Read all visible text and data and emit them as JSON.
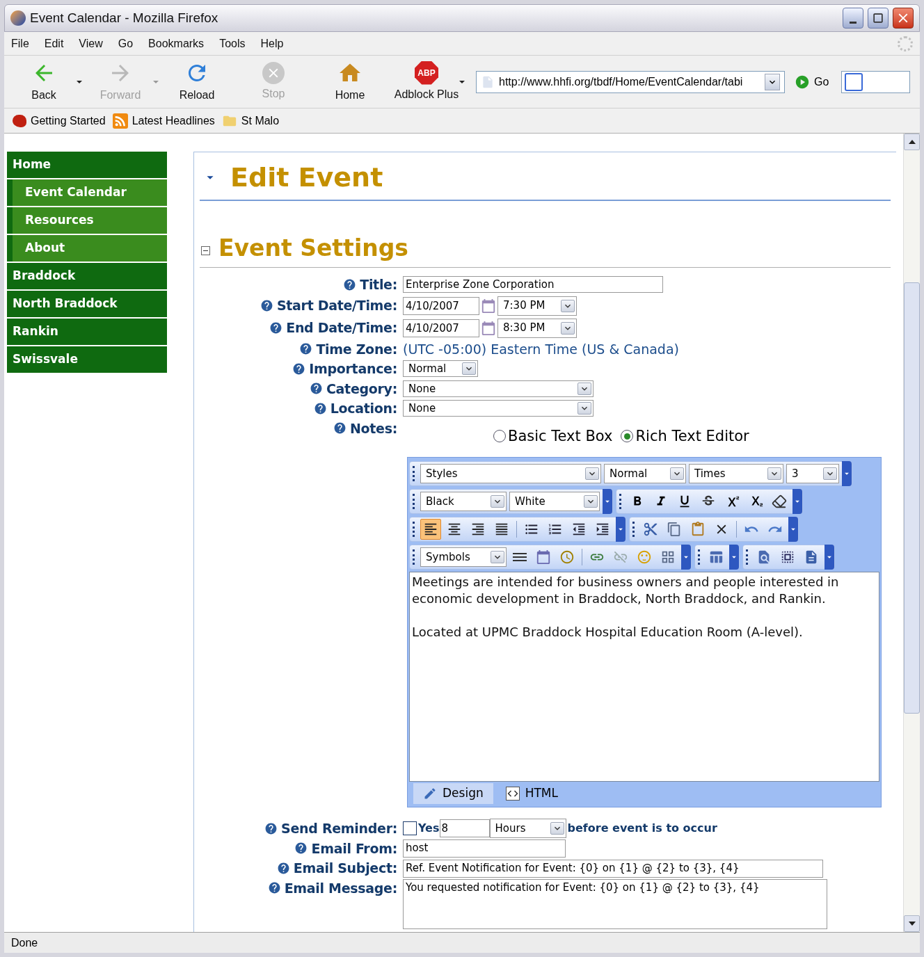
{
  "window": {
    "title": "Event Calendar - Mozilla Firefox"
  },
  "menu": [
    {
      "label": "File"
    },
    {
      "label": "Edit"
    },
    {
      "label": "View"
    },
    {
      "label": "Go"
    },
    {
      "label": "Bookmarks"
    },
    {
      "label": "Tools"
    },
    {
      "label": "Help"
    }
  ],
  "nav_buttons": [
    {
      "kind": "back",
      "label": "Back",
      "disabled": false,
      "dropdown": true
    },
    {
      "kind": "forward",
      "label": "Forward",
      "disabled": true,
      "dropdown": true
    },
    {
      "kind": "reload",
      "label": "Reload",
      "disabled": false,
      "dropdown": false
    },
    {
      "kind": "stop",
      "label": "Stop",
      "disabled": true,
      "dropdown": false
    },
    {
      "kind": "home",
      "label": "Home",
      "disabled": false,
      "dropdown": false
    },
    {
      "kind": "adblock",
      "label": "Adblock Plus",
      "badge": "ABP",
      "disabled": false,
      "dropdown": true
    }
  ],
  "address": {
    "value": "http://www.hhfi.org/tbdf/Home/EventCalendar/tabi"
  },
  "go": {
    "label": "Go"
  },
  "bookmarks": [
    {
      "kind": "starter",
      "label": "Getting Started"
    },
    {
      "kind": "feed",
      "label": "Latest Headlines"
    },
    {
      "kind": "folder",
      "label": "St Malo"
    }
  ],
  "sidebar": {
    "items": [
      {
        "label": "Home",
        "children": [
          {
            "label": "Event Calendar"
          },
          {
            "label": "Resources"
          },
          {
            "label": "About"
          }
        ]
      },
      {
        "label": "Braddock"
      },
      {
        "label": "North Braddock"
      },
      {
        "label": "Rankin"
      },
      {
        "label": "Swissvale"
      }
    ]
  },
  "page": {
    "heading": "Edit Event",
    "heading_expanded": true,
    "section": {
      "title": "Event Settings",
      "expanded": true
    }
  },
  "form": {
    "fields": [
      {
        "kind": "text",
        "label": "Title:",
        "value": "Enterprise Zone Corporation"
      },
      {
        "kind": "datetime",
        "label": "Start Date/Time:",
        "date": "4/10/2007",
        "time": "7:30 PM"
      },
      {
        "kind": "datetime",
        "label": "End Date/Time:",
        "date": "4/10/2007",
        "time": "8:30 PM"
      },
      {
        "kind": "static",
        "label": "Time Zone:",
        "value": "(UTC -05:00) Eastern Time (US & Canada)"
      },
      {
        "kind": "short-select",
        "label": "Importance:",
        "value": "Normal"
      },
      {
        "kind": "select",
        "label": "Category:",
        "value": "None"
      },
      {
        "kind": "select",
        "label": "Location:",
        "value": "None"
      },
      {
        "kind": "notes",
        "label": "Notes:"
      }
    ]
  },
  "editor": {
    "modes": [
      {
        "label": "Basic Text Box",
        "selected": false
      },
      {
        "label": "Rich Text Editor",
        "selected": true
      }
    ],
    "toolbars": [
      [
        [
          {
            "kind": "select",
            "value": "Styles"
          },
          {
            "kind": "select",
            "value": "Normal"
          },
          {
            "kind": "select",
            "value": "Times"
          },
          {
            "kind": "select",
            "value": "3"
          }
        ]
      ],
      [
        [
          {
            "kind": "select",
            "value": "Black"
          },
          {
            "kind": "select",
            "value": "White"
          }
        ],
        [
          {
            "kind": "tool",
            "selected": false
          },
          {
            "kind": "tool",
            "selected": false
          },
          {
            "kind": "tool",
            "selected": false
          },
          {
            "kind": "tool",
            "selected": false
          },
          {
            "kind": "tool",
            "selected": false
          },
          {
            "kind": "tool",
            "selected": false
          },
          {
            "kind": "tool",
            "selected": false
          }
        ]
      ],
      [
        [
          {
            "kind": "tool",
            "selected": true
          },
          {
            "kind": "tool",
            "selected": false
          },
          {
            "kind": "tool",
            "selected": false
          },
          {
            "kind": "tool",
            "selected": false
          },
          {
            "kind": "separator"
          },
          {
            "kind": "tool",
            "selected": false
          },
          {
            "kind": "tool",
            "selected": false
          },
          {
            "kind": "tool",
            "selected": false
          },
          {
            "kind": "tool",
            "selected": false
          }
        ],
        [
          {
            "kind": "tool",
            "selected": false
          },
          {
            "kind": "tool",
            "selected": false
          },
          {
            "kind": "tool",
            "selected": false
          },
          {
            "kind": "tool",
            "selected": false
          },
          {
            "kind": "separator"
          },
          {
            "kind": "tool",
            "selected": false
          },
          {
            "kind": "tool",
            "selected": false
          }
        ]
      ],
      [
        [
          {
            "kind": "select",
            "value": "Symbols"
          },
          {
            "kind": "tool",
            "selected": false
          },
          {
            "kind": "tool",
            "selected": false
          },
          {
            "kind": "tool",
            "selected": false
          },
          {
            "kind": "separator"
          },
          {
            "kind": "tool",
            "selected": false
          },
          {
            "kind": "tool",
            "selected": false
          },
          {
            "kind": "tool",
            "selected": false
          },
          {
            "kind": "tool",
            "selected": false
          }
        ],
        [
          {
            "kind": "tool",
            "selected": false
          }
        ],
        [
          {
            "kind": "tool",
            "selected": false
          },
          {
            "kind": "tool",
            "selected": false
          },
          {
            "kind": "tool",
            "selected": false
          }
        ]
      ]
    ],
    "paragraphs": [
      "Meetings are intended for business owners and people interested in economic development in Braddock, North Braddock, and Rankin.",
      "Located at UPMC Braddock Hospital Education Room (A-level)."
    ],
    "tabs": [
      {
        "label": "Design",
        "selected": true
      },
      {
        "label": "HTML",
        "selected": false
      }
    ]
  },
  "reminder": {
    "label": "Send Reminder:",
    "checked": false,
    "option_label": "Yes",
    "value": "8",
    "unit": "Hours",
    "suffix": "before event is to occur"
  },
  "email_fields": [
    {
      "kind": "short",
      "label": "Email From:",
      "value": "host"
    },
    {
      "kind": "line",
      "label": "Email Subject:",
      "value": "Ref. Event Notification for Event: {0} on {1} @ {2} to {3}, {4}"
    },
    {
      "kind": "area",
      "label": "Email Message:",
      "value": "You requested notification for Event: {0} on {1} @ {2} to {3}, {4}"
    }
  ],
  "status_bar": {
    "text": "Done"
  }
}
